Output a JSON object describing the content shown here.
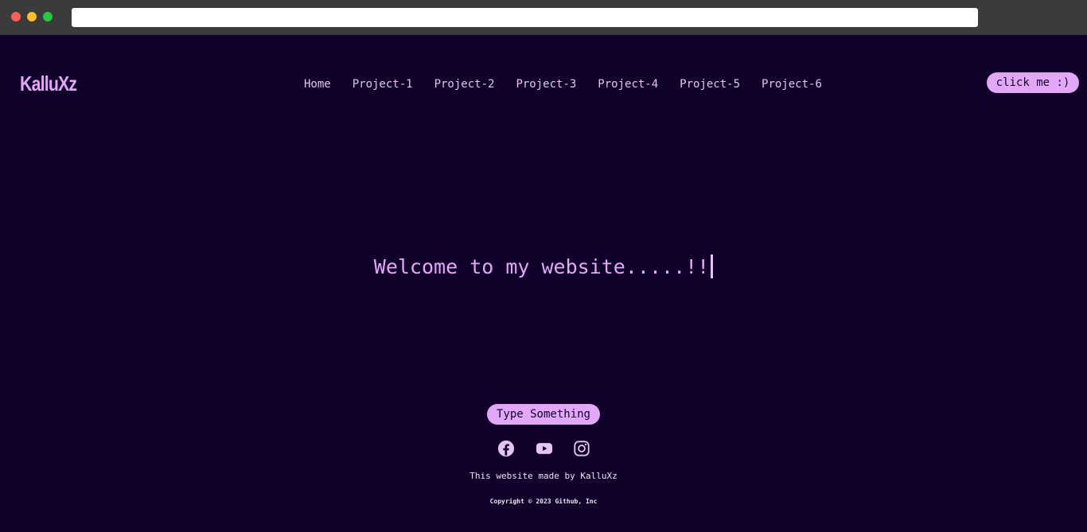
{
  "browser": {
    "url": ""
  },
  "header": {
    "logo": "KalluXz",
    "nav": [
      "Home",
      "Project-1",
      "Project-2",
      "Project-3",
      "Project-4",
      "Project-5",
      "Project-6"
    ],
    "cta_label": "click me :)"
  },
  "hero": {
    "headline": "Welcome to my website.....!!"
  },
  "footer": {
    "type_button_label": "Type Something",
    "social_icons": [
      "facebook-icon",
      "youtube-icon",
      "instagram-icon"
    ],
    "made_by": "This website made by KalluXz",
    "copyright": "Copyright © 2023 Github, Inc"
  },
  "colors": {
    "background": "#11002a",
    "accent": "#e3a7f8",
    "chrome": "#3b3b3b"
  }
}
